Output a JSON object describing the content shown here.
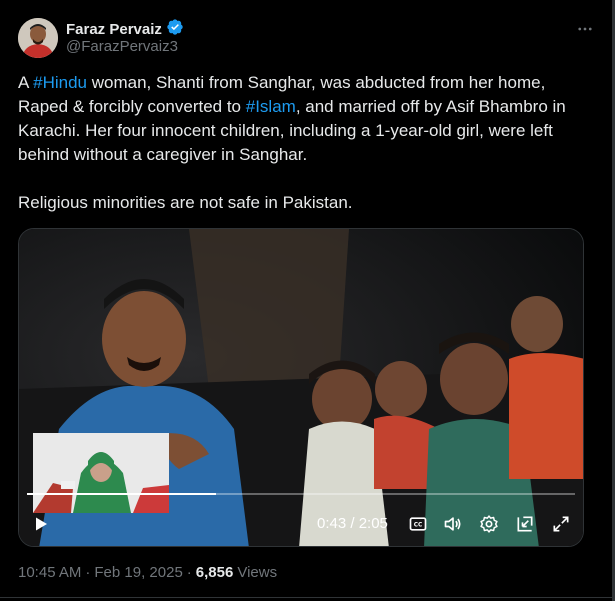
{
  "author": {
    "display_name": "Faraz Pervaiz",
    "handle": "@FarazPervaiz3",
    "verified": true,
    "avatar_icon": "profile-photo",
    "verified_icon": "verified-badge-icon"
  },
  "menu": {
    "icon": "more-horizontal-icon",
    "label": "···"
  },
  "tweet": {
    "p1_a": "A ",
    "hashtag1": "#Hindu",
    "p1_b": " woman, Shanti from Sanghar, was abducted from her home, Raped & forcibly converted to ",
    "hashtag2": "#Islam",
    "p1_c": ", and married off by Asif Bhambro in Karachi. Her four innocent children, including a 1-year-old girl, were left behind without a caregiver in Sanghar.",
    "p2": "Religious minorities are not safe in Pakistan."
  },
  "video": {
    "time": "0:43 / 2:05",
    "progress_fraction": 0.344,
    "controls": {
      "play": "play-icon",
      "captions": "captions-icon",
      "volume": "volume-icon",
      "settings": "settings-icon",
      "pip": "picture-in-picture-icon",
      "fullscreen": "fullscreen-icon"
    }
  },
  "meta": {
    "time": "10:45 AM",
    "sep1": "·",
    "date": "Feb 19, 2025",
    "sep2": "·",
    "views_count": "6,856",
    "views_label": "Views"
  },
  "colors": {
    "background": "#000000",
    "text": "#e7e9ea",
    "secondary": "#71767b",
    "link": "#1d9bf0",
    "verified": "#1d9bf0"
  }
}
